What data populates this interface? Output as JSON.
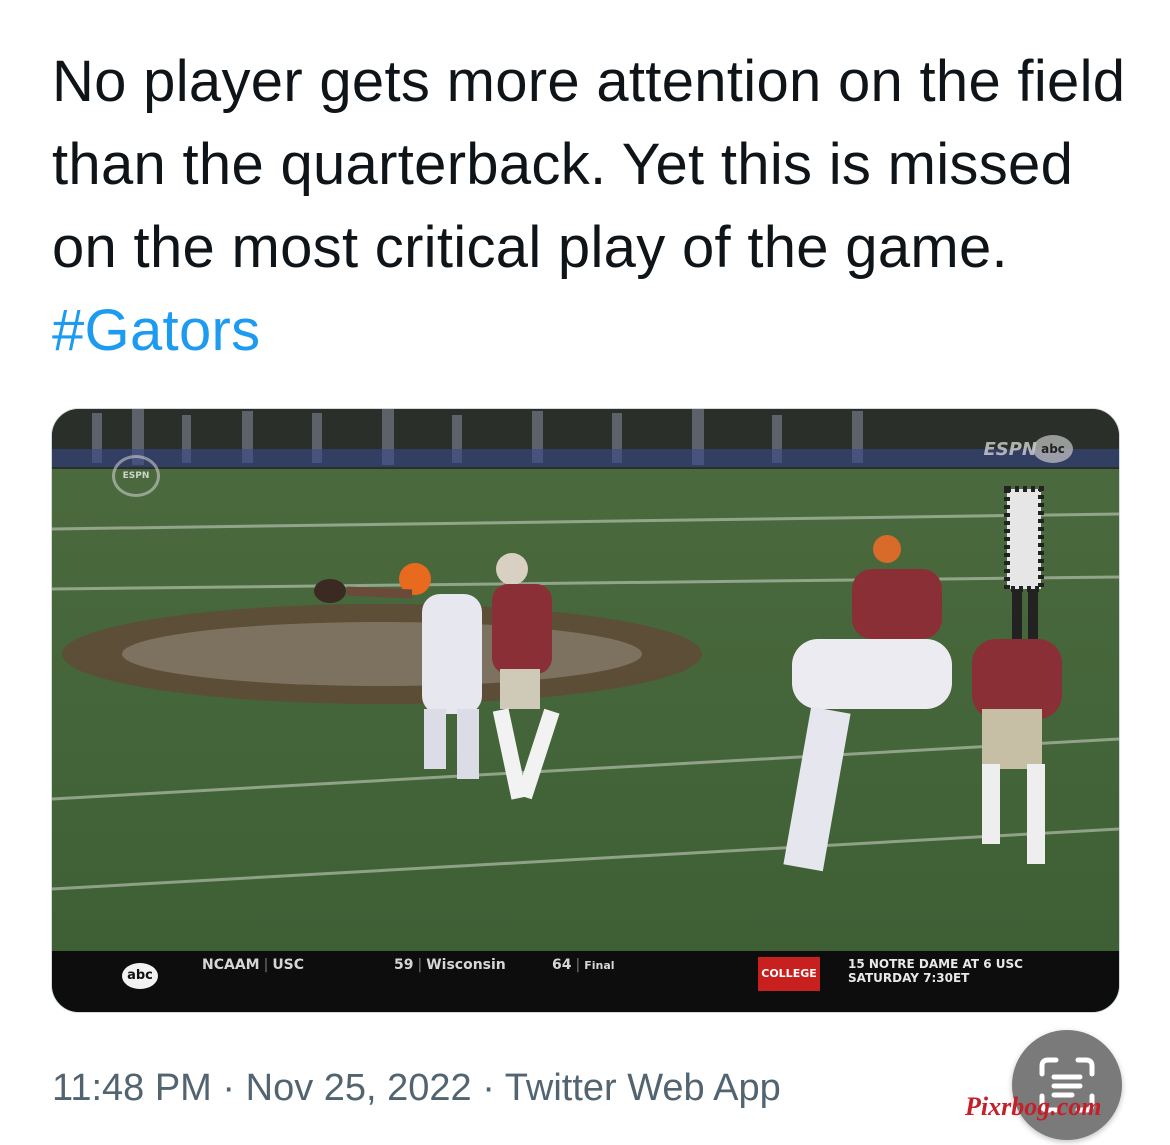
{
  "tweet": {
    "text_before_hashtag": "No player gets more attention on the field than the quarterback. Yet this is missed on the most critical play of the game. ",
    "hashtag": "#Gators"
  },
  "media": {
    "network_logo": "ESPN",
    "broadcast_mark": "ESPN",
    "bug": "abc",
    "ticker": {
      "logo": "abc",
      "league": "NCAAM",
      "team1": "USC",
      "score1": "59",
      "team2": "Wisconsin",
      "score2": "64",
      "status": "Final",
      "promo_badge": "COLLEGE",
      "promo_line1": "15 NOTRE DAME AT 6 USC",
      "promo_line2": "SATURDAY 7:30ET"
    }
  },
  "meta": {
    "time": "11:48 PM",
    "date": "Nov 25, 2022",
    "source": "Twitter Web App",
    "separator": " · "
  },
  "overlay": {
    "scan_icon": "text-scan-icon",
    "watermark": "Pixrbog.com"
  },
  "colors": {
    "hashtag": "#1d9bf0",
    "meta": "#536471",
    "watermark": "#c51f2a"
  }
}
